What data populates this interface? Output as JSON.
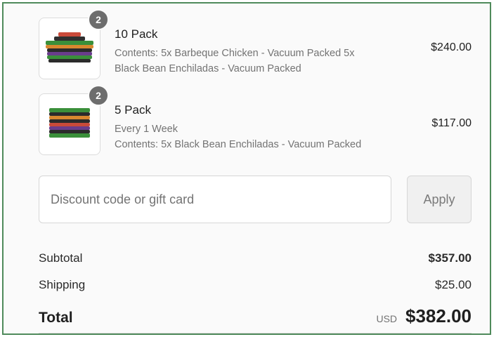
{
  "cart": {
    "items": [
      {
        "quantity": "2",
        "name": "10 Pack",
        "details": [
          "Contents: 5x Barbeque Chicken - Vacuum Packed 5x",
          "Black Bean Enchiladas - Vacuum Packed"
        ],
        "price": "$240.00",
        "icon": "stacked-meal-packs-image"
      },
      {
        "quantity": "2",
        "name": "5 Pack",
        "details": [
          "Every 1 Week",
          "Contents: 5x Black Bean Enchiladas - Vacuum Packed"
        ],
        "price": "$117.00",
        "icon": "stacked-meal-packs-image"
      }
    ]
  },
  "discount": {
    "placeholder": "Discount code or gift card",
    "value": "",
    "apply_label": "Apply"
  },
  "summary": {
    "subtotal_label": "Subtotal",
    "subtotal_value": "$357.00",
    "shipping_label": "Shipping",
    "shipping_value": "$25.00",
    "total_label": "Total",
    "currency": "USD",
    "total_value": "$382.00"
  },
  "colors": {
    "frame_border": "#4f8a5b",
    "badge": "#6d6d6d"
  }
}
